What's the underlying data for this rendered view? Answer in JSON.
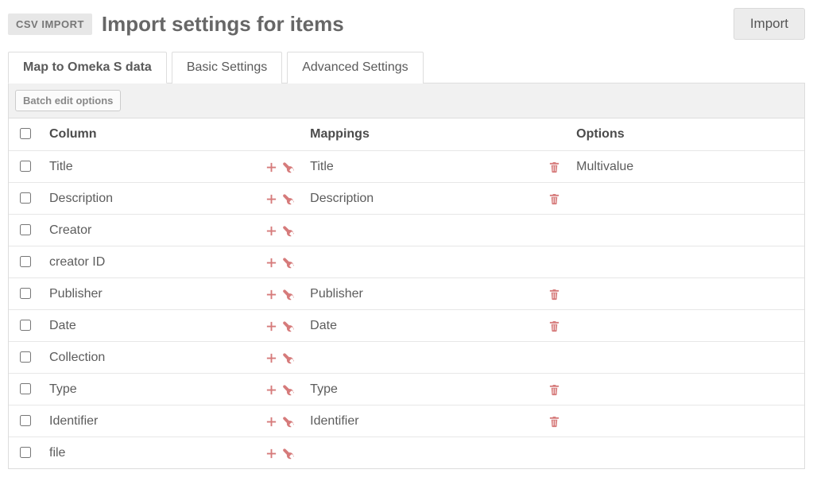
{
  "header": {
    "badge": "CSV IMPORT",
    "title": "Import settings for items",
    "import_button": "Import"
  },
  "tabs": [
    {
      "label": "Map to Omeka S data",
      "active": true
    },
    {
      "label": "Basic Settings",
      "active": false
    },
    {
      "label": "Advanced Settings",
      "active": false
    }
  ],
  "batch_button": "Batch edit options",
  "columns_header": {
    "column": "Column",
    "mappings": "Mappings",
    "options": "Options"
  },
  "rows": [
    {
      "column": "Title",
      "mapping": "Title",
      "has_trash": true,
      "options": "Multivalue"
    },
    {
      "column": "Description",
      "mapping": "Description",
      "has_trash": true,
      "options": ""
    },
    {
      "column": "Creator",
      "mapping": "",
      "has_trash": false,
      "options": ""
    },
    {
      "column": "creator ID",
      "mapping": "",
      "has_trash": false,
      "options": ""
    },
    {
      "column": "Publisher",
      "mapping": "Publisher",
      "has_trash": true,
      "options": ""
    },
    {
      "column": "Date",
      "mapping": "Date",
      "has_trash": true,
      "options": ""
    },
    {
      "column": "Collection",
      "mapping": "",
      "has_trash": false,
      "options": ""
    },
    {
      "column": "Type",
      "mapping": "Type",
      "has_trash": true,
      "options": ""
    },
    {
      "column": "Identifier",
      "mapping": "Identifier",
      "has_trash": true,
      "options": ""
    },
    {
      "column": "file",
      "mapping": "",
      "has_trash": false,
      "options": ""
    }
  ]
}
